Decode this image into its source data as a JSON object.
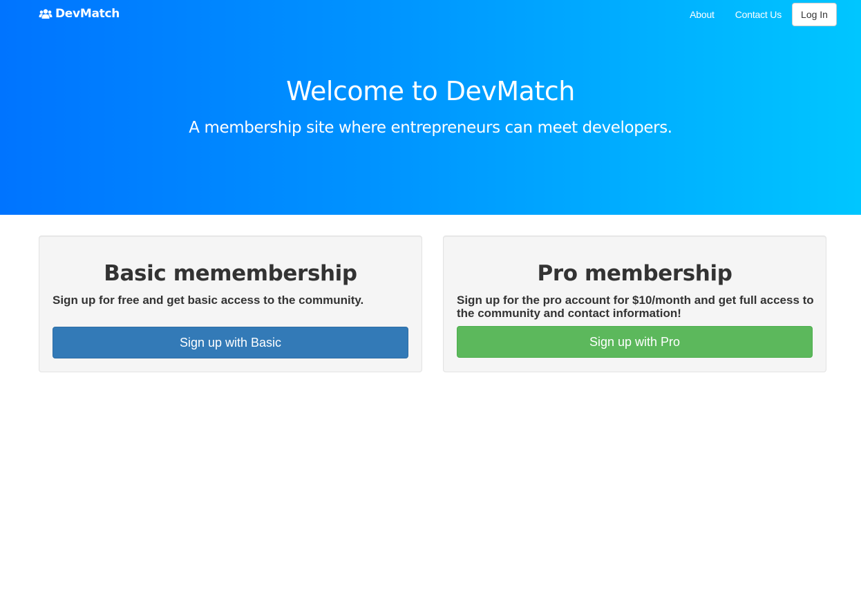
{
  "nav": {
    "brand": "DevMatch",
    "brand_icon": "users-icon",
    "links": [
      {
        "label": "About"
      },
      {
        "label": "Contact Us"
      }
    ],
    "login_label": "Log In"
  },
  "hero": {
    "title": "Welcome to DevMatch",
    "subtitle": "A membership site where entrepreneurs can meet developers."
  },
  "plans": [
    {
      "title": "Basic memembership",
      "description": "Sign up for free and get basic access to the community.",
      "button_label": "Sign up with Basic",
      "button_color": "#337ab7"
    },
    {
      "title": "Pro membership",
      "description": "Sign up for the pro account for $10/month and get full access to the community and contact information!",
      "button_label": "Sign up with Pro",
      "button_color": "#5cb85c"
    }
  ],
  "colors": {
    "hero_gradient_start": "#0074ff",
    "hero_gradient_end": "#00c6ff",
    "card_background": "#f5f5f5"
  }
}
